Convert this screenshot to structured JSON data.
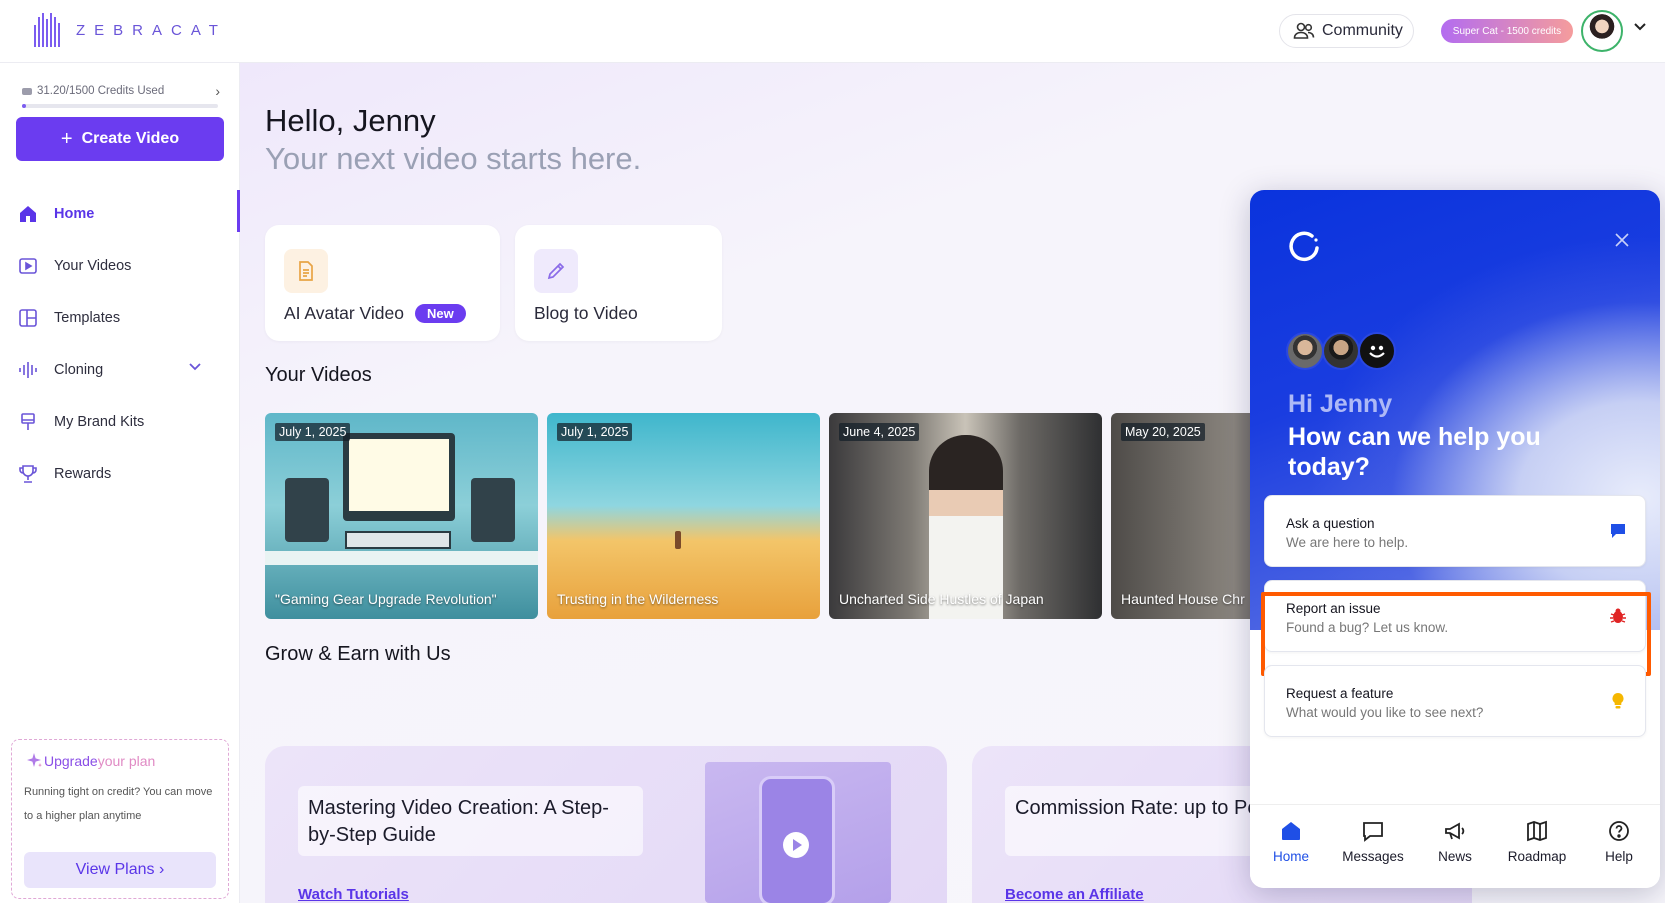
{
  "header": {
    "brand": "ZEBRACAT",
    "community_label": "Community",
    "plan_badge": "Super Cat - 1500 credits"
  },
  "sidebar": {
    "credits_text": "31.20/1500 Credits Used",
    "credits_fraction": 0.0208,
    "create_label": "Create Video",
    "items": [
      {
        "label": "Home",
        "icon": "home-icon"
      },
      {
        "label": "Your Videos",
        "icon": "video-icon"
      },
      {
        "label": "Templates",
        "icon": "templates-icon"
      },
      {
        "label": "Cloning",
        "icon": "waveform-icon"
      },
      {
        "label": "My Brand Kits",
        "icon": "brand-kit-icon"
      },
      {
        "label": "Rewards",
        "icon": "trophy-icon"
      }
    ],
    "upgrade": {
      "title_a": "Upgrade ",
      "title_b": "your plan",
      "desc": "Running tight on credit? You can move to a higher plan anytime",
      "button": "View Plans"
    }
  },
  "main": {
    "greeting": "Hello, Jenny",
    "subgreeting": "Your next video starts here.",
    "tiles": [
      {
        "label": "AI Avatar Video",
        "badge": "New"
      },
      {
        "label": "Blog to Video"
      }
    ],
    "videos_title": "Your Videos",
    "videos": [
      {
        "date": "July 1, 2025",
        "title": "\"Gaming Gear Upgrade Revolution\""
      },
      {
        "date": "July 1, 2025",
        "title": "Trusting in the Wilderness"
      },
      {
        "date": "June 4, 2025",
        "title": "Uncharted Side Hustles of Japan"
      },
      {
        "date": "May 20, 2025",
        "title": "Haunted House Chr"
      }
    ],
    "grow_title": "Grow & Earn with Us",
    "grow_cards": [
      {
        "text": "Mastering Video Creation: A Step-by-Step Guide",
        "link": "Watch Tutorials"
      },
      {
        "text": "Commission Rate: up to Per Sale",
        "link": "Become an Affiliate"
      }
    ]
  },
  "help_panel": {
    "hi": "Hi Jenny",
    "question": "How can we help you today?",
    "options": [
      {
        "title": "Ask a question",
        "desc": "We are here to help.",
        "icon": "chat-icon"
      },
      {
        "title": "Report an issue",
        "desc": "Found a bug? Let us know.",
        "icon": "bug-icon"
      },
      {
        "title": "Request a feature",
        "desc": "What would you like to see next?",
        "icon": "lightbulb-icon"
      }
    ],
    "tabs": [
      {
        "label": "Home"
      },
      {
        "label": "Messages"
      },
      {
        "label": "News"
      },
      {
        "label": "Roadmap"
      },
      {
        "label": "Help"
      }
    ]
  },
  "colors": {
    "accent": "#6b3cf0",
    "panel_blue": "#1a3de0",
    "highlight": "#ff5a00"
  }
}
